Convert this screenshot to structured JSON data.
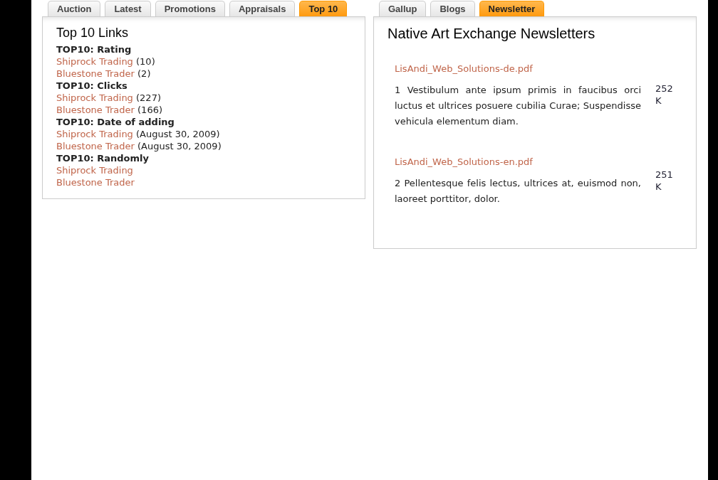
{
  "left_panel": {
    "tabs": [
      {
        "label": "Auction",
        "selected": false
      },
      {
        "label": "Latest",
        "selected": false
      },
      {
        "label": "Promotions",
        "selected": false
      },
      {
        "label": "Appraisals",
        "selected": false
      },
      {
        "label": "Top 10",
        "selected": true
      }
    ],
    "title": "Top 10 Links",
    "sections": [
      {
        "heading": "TOP10: Rating",
        "entries": [
          {
            "link": "Shiprock Trading",
            "note": "(10)"
          },
          {
            "link": "Bluestone Trader",
            "note": "(2)"
          }
        ]
      },
      {
        "heading": "TOP10: Clicks",
        "entries": [
          {
            "link": "Shiprock Trading",
            "note": "(227)"
          },
          {
            "link": "Bluestone Trader",
            "note": "(166)"
          }
        ]
      },
      {
        "heading": "TOP10: Date of adding",
        "entries": [
          {
            "link": "Shiprock Trading",
            "note": "(August 30, 2009)"
          },
          {
            "link": "Bluestone Trader",
            "note": "(August 30, 2009)"
          }
        ]
      },
      {
        "heading": "TOP10: Randomly",
        "entries": [
          {
            "link": "Shiprock Trading"
          },
          {
            "link": "Bluestone Trader"
          }
        ]
      }
    ]
  },
  "right_panel": {
    "tabs": [
      {
        "label": "Gallup",
        "selected": false
      },
      {
        "label": "Blogs",
        "selected": false
      },
      {
        "label": "Newsletter",
        "selected": true
      }
    ],
    "title": "Native Art Exchange Newsletters",
    "files": [
      {
        "link": "LisAndi_Web_Solutions-de.pdf",
        "description": "1 Vestibulum ante ipsum primis in faucibus orci luctus et ultrices posuere cubilia Curae; Suspendisse vehicula elementum diam.",
        "size": "252 K"
      },
      {
        "link": "LisAndi_Web_Solutions-en.pdf",
        "description": "2 Pellentesque felis lectus, ultrices at, euismod non, laoreet porttitor, dolor.",
        "size": "251 K"
      }
    ]
  }
}
